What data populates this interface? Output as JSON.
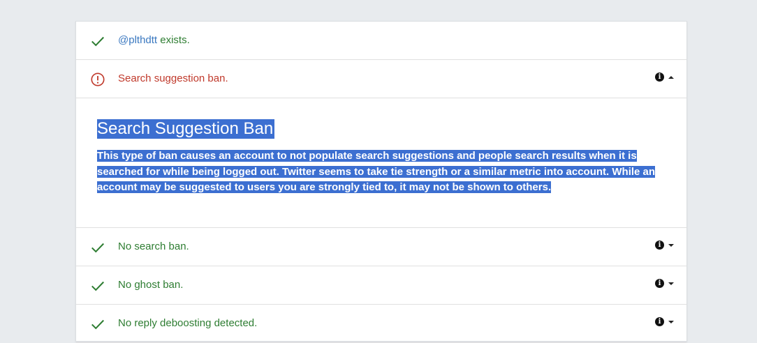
{
  "rows": {
    "exists": {
      "handle": "@plthdtt",
      "suffix": " exists."
    },
    "search_suggestion_ban": {
      "label": "Search suggestion ban."
    },
    "search_ban": {
      "label": "No search ban."
    },
    "ghost_ban": {
      "label": "No ghost ban."
    },
    "reply_deboosting": {
      "label": "No reply deboosting detected."
    }
  },
  "details": {
    "title": "Search Suggestion Ban",
    "body": "This type of ban causes an account to not populate search suggestions and people search results when it is searched for while being logged out. Twitter seems to take tie strength or a similar metric into account. While an account may be suggested to users you are strongly tied to, it may not be shown to others."
  },
  "icons": {
    "ok": "checkmark-icon",
    "bad": "exclamation-circle-icon",
    "info": "info-icon",
    "caret_down": "caret-down-icon",
    "caret_up": "caret-up-icon"
  },
  "colors": {
    "ok": "#2e7d32",
    "bad": "#c0392b",
    "handle": "#3a78c0",
    "selection": "#3c6fd1",
    "background": "#e8ebee"
  }
}
